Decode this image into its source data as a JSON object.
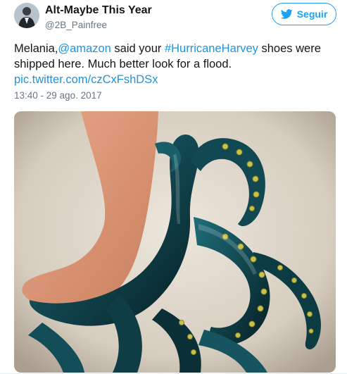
{
  "user": {
    "display_name": "Alt-Maybe This Year",
    "handle": "@2B_Painfree"
  },
  "follow_button": {
    "label": "Seguir",
    "icon": "twitter-bird-icon"
  },
  "tweet": {
    "text_1": "Melania,",
    "mention": "@amazon",
    "text_2": " said your ",
    "hashtag": "#HurricaneHarvey",
    "text_3": " shoes were shipped here. Much better look for a flood.",
    "link": "pic.twitter.com/czCxFshDSx",
    "timestamp": "13:40 - 29 ago. 2017"
  },
  "media": {
    "subject": "octopus-tentacle-heel-shoe-photo"
  },
  "colors": {
    "accent": "#1da1f2",
    "link": "#1b95e0",
    "secondary_text": "#657786"
  }
}
